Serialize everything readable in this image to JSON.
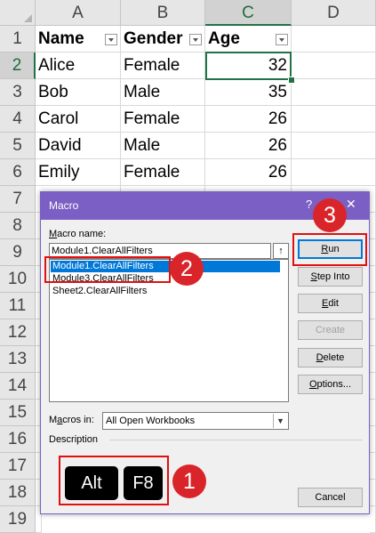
{
  "sheet": {
    "columns": [
      "A",
      "B",
      "C",
      "D"
    ],
    "selected_column": "C",
    "rows": [
      "1",
      "2",
      "3",
      "4",
      "5",
      "6",
      "7",
      "8",
      "9",
      "10",
      "11",
      "12",
      "13",
      "14",
      "15",
      "16",
      "17",
      "18",
      "19"
    ],
    "selected_row": "2",
    "headers": [
      "Name",
      "Gender",
      "Age"
    ],
    "data": [
      [
        "Alice",
        "Female",
        "32"
      ],
      [
        "Bob",
        "Male",
        "35"
      ],
      [
        "Carol",
        "Female",
        "26"
      ],
      [
        "David",
        "Male",
        "26"
      ],
      [
        "Emily",
        "Female",
        "26"
      ]
    ],
    "active_cell": "C2"
  },
  "dialog": {
    "title": "Macro",
    "help": "?",
    "close": "✕",
    "macro_name_label_u": "M",
    "macro_name_label_rest": "acro name:",
    "macro_name_value": "Module1.ClearAllFilters",
    "up_arrow": "↑",
    "macros": [
      "Module1.ClearAllFilters",
      "Module3.ClearAllFilters",
      "Sheet2.ClearAllFilters"
    ],
    "selected_macro": "Module1.ClearAllFilters",
    "buttons": {
      "run_u": "R",
      "run_rest": "un",
      "step_into_u": "S",
      "step_into_rest": "tep Into",
      "edit_u": "E",
      "edit_rest": "dit",
      "create": "Create",
      "delete_u": "D",
      "delete_rest": "elete",
      "options_u": "O",
      "options_rest": "ptions...",
      "cancel": "Cancel"
    },
    "macros_in_label_pre": "M",
    "macros_in_label_u": "a",
    "macros_in_label_rest": "cros in:",
    "macros_in_value": "All Open Workbooks",
    "description_label": "Description"
  },
  "keys": [
    "Alt",
    "F8"
  ],
  "badges": [
    "1",
    "2",
    "3"
  ],
  "colors": {
    "accent": "#7b5fc4",
    "highlight_red": "#e01010",
    "badge_red": "#d9252a",
    "excel_green": "#217346",
    "selection_blue": "#0078d7"
  }
}
